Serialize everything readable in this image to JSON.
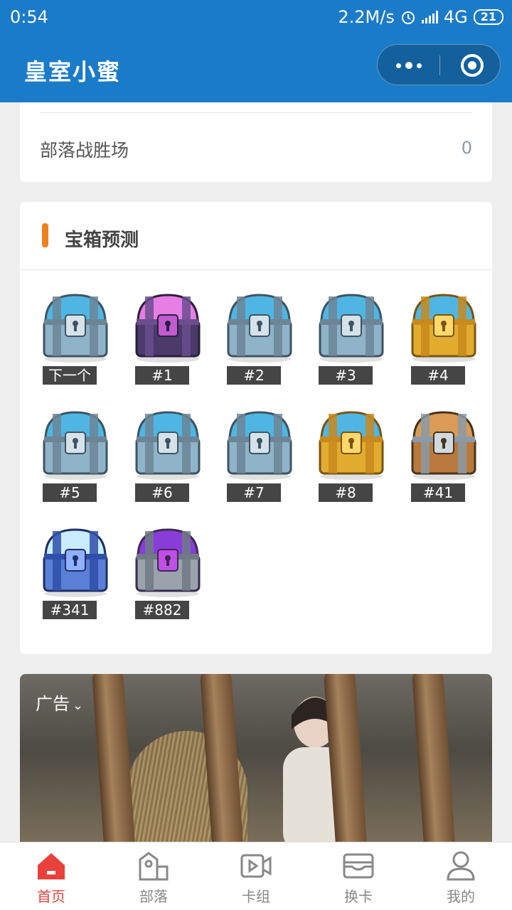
{
  "status_bar": {
    "time": "0:54",
    "speed": "2.2M/s",
    "network": "4G",
    "battery": "21"
  },
  "header": {
    "title": "皇室小蜜"
  },
  "clan_stats": {
    "row": {
      "label": "部落战胜场",
      "value": "0"
    }
  },
  "chest_prediction": {
    "title": "宝箱预测",
    "chests": [
      {
        "label": "下一个",
        "type": "silver"
      },
      {
        "label": "#1",
        "type": "magical"
      },
      {
        "label": "#2",
        "type": "silver"
      },
      {
        "label": "#3",
        "type": "silver"
      },
      {
        "label": "#4",
        "type": "golden"
      },
      {
        "label": "#5",
        "type": "silver"
      },
      {
        "label": "#6",
        "type": "silver"
      },
      {
        "label": "#7",
        "type": "silver"
      },
      {
        "label": "#8",
        "type": "golden"
      },
      {
        "label": "#41",
        "type": "giant"
      },
      {
        "label": "#341",
        "type": "lightning"
      },
      {
        "label": "#882",
        "type": "epic"
      }
    ]
  },
  "ad": {
    "label": "广告"
  },
  "tabs": [
    {
      "label": "首页",
      "icon": "home-icon",
      "active": true
    },
    {
      "label": "部落",
      "icon": "clan-house-icon",
      "active": false
    },
    {
      "label": "卡组",
      "icon": "video-icon",
      "active": false
    },
    {
      "label": "换卡",
      "icon": "card-wallet-icon",
      "active": false
    },
    {
      "label": "我的",
      "icon": "user-icon",
      "active": false
    }
  ],
  "colors": {
    "primary": "#1a7bc9",
    "accent": "#f07f1e",
    "active_tab": "#e8413b"
  }
}
